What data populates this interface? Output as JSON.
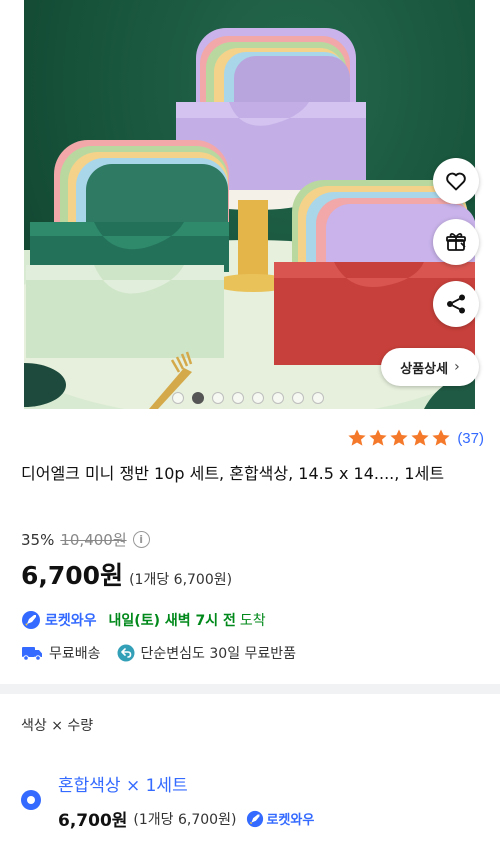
{
  "hero": {
    "image_alt": "",
    "detail_button": "상품상세",
    "carousel": {
      "total": 8,
      "active_index": 1
    },
    "icons": [
      "heart-icon",
      "gift-icon",
      "share-icon"
    ]
  },
  "rating": {
    "stars": 5,
    "count": "(37)",
    "star_color": "#f5792a"
  },
  "product": {
    "title": "디어엘크 미니 쟁반 10p 세트, 혼합색상, 14.5 x 14...., 1세트"
  },
  "price": {
    "discount": "35%",
    "original": "10,400원",
    "sale": "6,700원",
    "unit": "(1개당 6,700원)"
  },
  "delivery": {
    "badge": "로켓와우",
    "arrival_strong": "내일(토) 새벽 7시 전",
    "arrival_rest": "도착"
  },
  "shipping": {
    "free_shipping": "무료배송",
    "free_return": "단순변심도 30일 무료반품"
  },
  "options": {
    "header": "색상 × 수량",
    "selected": {
      "name": "혼합색상 × 1세트",
      "price": "6,700원",
      "unit": "(1개당 6,700원)",
      "badge": "로켓와우"
    }
  },
  "colors": {
    "accent": "#346aff",
    "arrival": "#00891a",
    "star": "#f5792a"
  }
}
